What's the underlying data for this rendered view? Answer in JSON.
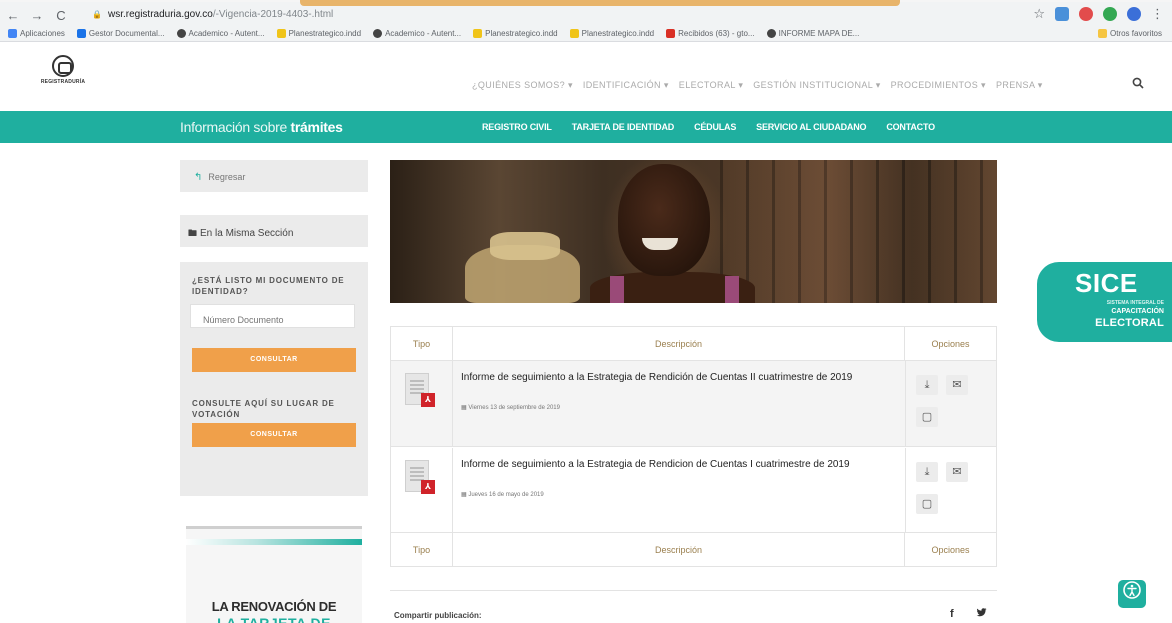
{
  "browser": {
    "nav": {
      "back": "←",
      "forward": "→",
      "reload": "C"
    },
    "url_domain": "wsr.registraduria.gov.co",
    "url_path": "/-Vigencia-2019-4403-.html",
    "bookmarks": [
      "Aplicaciones",
      "Gestor Documental...",
      "Academico - Autent...",
      "Planestrategico.indd",
      "Academico - Autent...",
      "Planestrategico.indd",
      "Planestrategico.indd",
      "Recibidos (63) - gto...",
      "INFORME MAPA DE..."
    ],
    "other_bookmarks": "Otros favoritos"
  },
  "header": {
    "logo_text": "REGISTRADURÍA",
    "menu": [
      "¿QUIÉNES SOMOS?",
      "IDENTIFICACIÓN",
      "ELECTORAL",
      "GESTIÓN INSTITUCIONAL",
      "PROCEDIMIENTOS",
      "PRENSA"
    ],
    "menu_separator": "▾"
  },
  "tealbar": {
    "brand_prefix": "Información sobre ",
    "brand_bold": "trámites",
    "menu": [
      "REGISTRO CIVIL",
      "TARJETA DE IDENTIDAD",
      "CÉDULAS",
      "SERVICIO AL CIUDADANO",
      "CONTACTO"
    ]
  },
  "sidebar": {
    "back_label": "Regresar",
    "section_label": "En la Misma Sección",
    "question_document": "¿ESTÁ LISTO MI DOCUMENTO DE IDENTIDAD?",
    "document_placeholder": "Número Documento",
    "consult_button": "CONSULTAR",
    "question_voting": "CONSULTE AQUÍ SU LUGAR DE VOTACIÓN",
    "consult_button_2": "CONSULTAR",
    "promo_line1": "LA RENOVACIÓN DE",
    "promo_line2": "LA TARJETA DE"
  },
  "table": {
    "col_tipo": "Tipo",
    "col_descripcion": "Descripción",
    "col_opciones": "Opciones",
    "rows": [
      {
        "title": "Informe de seguimiento a la Estrategia de Rendición de Cuentas II cuatrimestre de 2019",
        "date": "Viernes 13 de septiembre de 2019"
      },
      {
        "title": "Informe de seguimiento a la Estrategia de Rendicion de Cuentas I cuatrimestre de 2019",
        "date": "Jueves 16 de mayo de 2019"
      }
    ]
  },
  "share": {
    "label": "Compartir publicación:",
    "facebook": "f",
    "twitter": "🐦"
  },
  "sice": {
    "title": "SICE",
    "sub1": "SISTEMA INTEGRAL DE",
    "sub2": "CAPACITACIÓN",
    "sub3": "ELECTORAL"
  },
  "colors": {
    "teal": "#1faf9f",
    "orange": "#f0a04a",
    "pdf_red": "#d0232a"
  }
}
